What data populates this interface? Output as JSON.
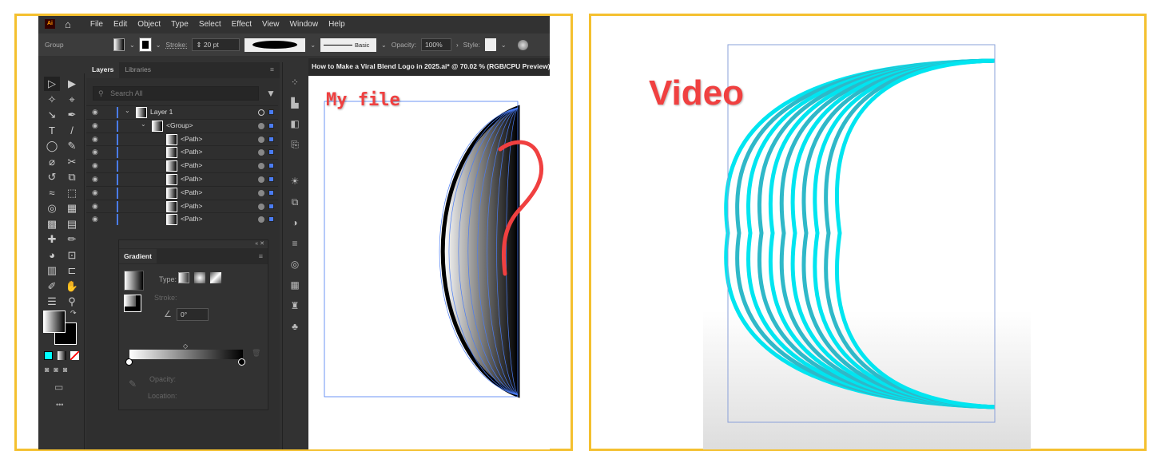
{
  "app": {
    "logo": "Ai",
    "menu": [
      "File",
      "Edit",
      "Object",
      "Type",
      "Select",
      "Effect",
      "View",
      "Window",
      "Help"
    ]
  },
  "control_bar": {
    "selection": "Group",
    "stroke_label": "Stroke:",
    "stroke_value": "20 pt",
    "brush_label": "Basic",
    "opacity_label": "Opacity:",
    "opacity_value": "100%",
    "style_label": "Style:"
  },
  "layers_panel": {
    "tabs": [
      "Layers",
      "Libraries"
    ],
    "search_placeholder": "Search All",
    "rows": [
      {
        "label": "Layer 1",
        "level": 0
      },
      {
        "label": "<Group>",
        "level": 1
      },
      {
        "label": "<Path>",
        "level": 2
      },
      {
        "label": "<Path>",
        "level": 2
      },
      {
        "label": "<Path>",
        "level": 2
      },
      {
        "label": "<Path>",
        "level": 2
      },
      {
        "label": "<Path>",
        "level": 2
      },
      {
        "label": "<Path>",
        "level": 2
      },
      {
        "label": "<Path>",
        "level": 2
      }
    ]
  },
  "gradient_panel": {
    "title": "Gradient",
    "type_label": "Type:",
    "stroke_label": "Stroke:",
    "angle": "0°",
    "opacity_label": "Opacity:",
    "location_label": "Location:"
  },
  "document": {
    "title": "How to Make a Viral Blend Logo in 2025.ai* @ 70.02 % (RGB/CPU Preview)"
  },
  "annotations": {
    "left": "My file",
    "right": "Video",
    "question_mark": "?"
  },
  "colors": {
    "frame": "#f4c02f",
    "selection": "#4a7cf4",
    "annotation": "#f04040",
    "cyan": "#00e5f0"
  }
}
